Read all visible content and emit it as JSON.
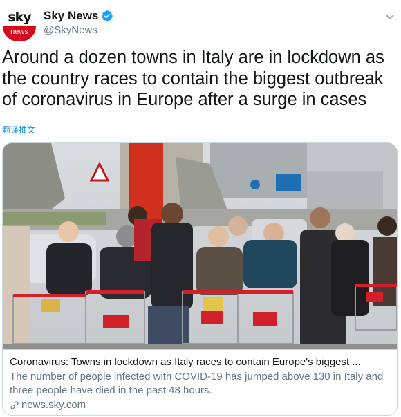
{
  "account": {
    "display_name": "Sky News",
    "handle": "@SkyNews",
    "avatar_word_top": "sky",
    "avatar_word_bottom": "news",
    "verified": true
  },
  "tweet": {
    "text": "Around a dozen towns in Italy are in lockdown as the country races to contain the biggest outbreak of coronavirus in Europe after a surge in cases",
    "translate_label": "翻译推文"
  },
  "card": {
    "image_description_icon": "photo-of-shoppers-in-masks",
    "title": "Coronavirus: Towns in lockdown as Italy races to contain Europe's biggest ...",
    "description": "The number of people infected with COVID-19 has jumped above 130 in Italy and three people have died in the past 48 hours.",
    "domain": "news.sky.com",
    "domain_icon": "link-icon"
  },
  "colors": {
    "brand_red": "#d4091d",
    "twitter_blue": "#1da1f2",
    "link_blue": "#1b95e0",
    "secondary_text": "#657786",
    "border": "#ccd6dd"
  }
}
